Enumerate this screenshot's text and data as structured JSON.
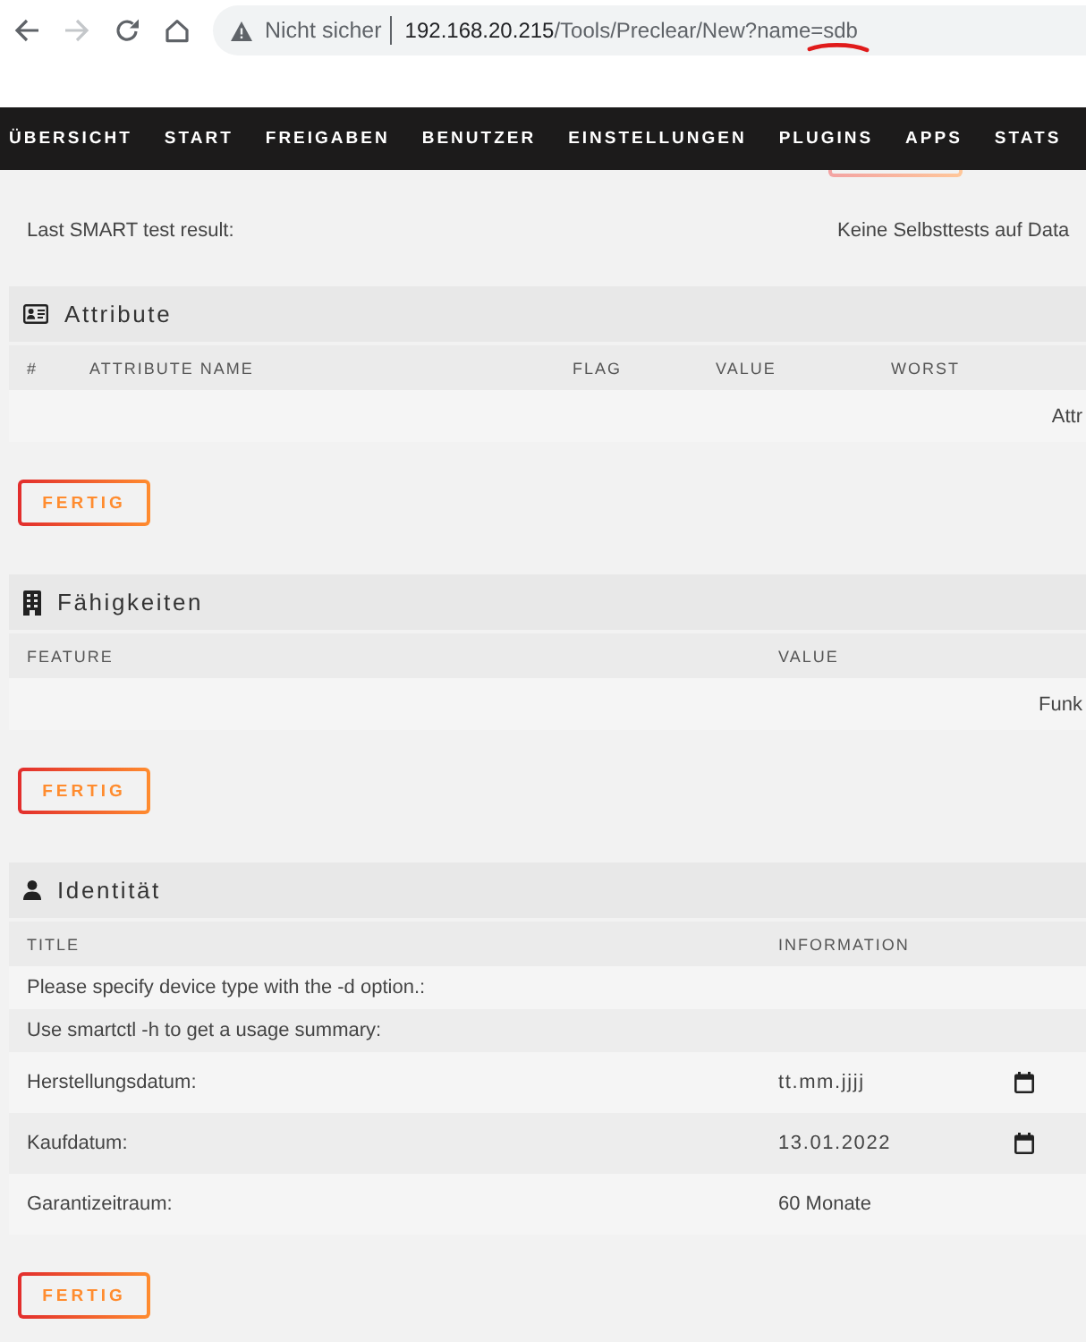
{
  "browser": {
    "toolbar": [
      {
        "kind": "back",
        "disabled": false
      },
      {
        "kind": "forward",
        "disabled": true
      },
      {
        "kind": "reload",
        "disabled": false
      },
      {
        "kind": "home",
        "disabled": false
      }
    ],
    "security_label": "Nicht sicher",
    "url_host": "192.168.20.215",
    "url_path": "/Tools/Preclear/New?name=sdb"
  },
  "nav": [
    "ÜBERSICHT",
    "START",
    "FREIGABEN",
    "BENUTZER",
    "EINSTELLUNGEN",
    "PLUGINS",
    "APPS",
    "STATS"
  ],
  "smart_result": {
    "label": "Last SMART test result:",
    "value": "Keine Selbsttests auf Data"
  },
  "sections": [
    {
      "kind": "attributes",
      "title": "Attribute",
      "columns": [
        "#",
        "ATTRIBUTE NAME",
        "FLAG",
        "VALUE",
        "WORST"
      ],
      "rows": [
        {
          "kind": "message",
          "text": "Attr"
        }
      ],
      "button": "FERTIG"
    },
    {
      "kind": "features",
      "title": "Fähigkeiten",
      "columns": [
        "FEATURE",
        "VALUE"
      ],
      "rows": [
        {
          "kind": "message",
          "text": "Funk"
        }
      ],
      "button": "FERTIG"
    },
    {
      "kind": "identity",
      "title": "Identität",
      "columns": [
        "TITLE",
        "INFORMATION"
      ],
      "rows": [
        {
          "kind": "text",
          "title": "Please specify device type with the -d option.:"
        },
        {
          "kind": "text",
          "title": "Use smartctl -h to get a usage summary:"
        },
        {
          "kind": "date",
          "title": "Herstellungsdatum:",
          "placeholder": "tt.mm.jjjj"
        },
        {
          "kind": "date",
          "title": "Kaufdatum:",
          "value": "13.01.2022"
        },
        {
          "kind": "text",
          "title": "Garantizeitraum:",
          "value": "60 Monate"
        }
      ],
      "button": "FERTIG"
    }
  ]
}
